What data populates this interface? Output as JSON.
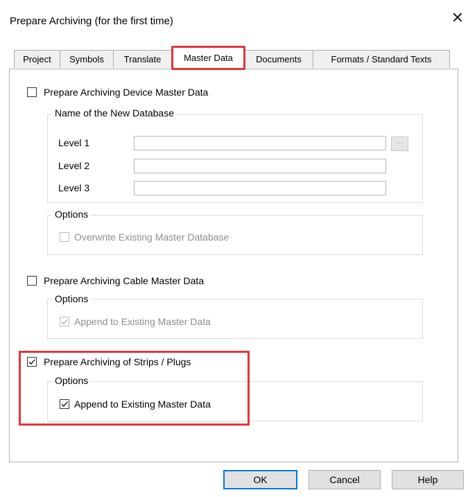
{
  "window": {
    "title": "Prepare Archiving (for the first time)",
    "close_glyph": "✕"
  },
  "tabs": [
    {
      "label": "Project",
      "active": false
    },
    {
      "label": "Symbols",
      "active": false
    },
    {
      "label": "Translate",
      "active": false
    },
    {
      "label": "Master Data",
      "active": true
    },
    {
      "label": "Documents",
      "active": false
    },
    {
      "label": "Formats / Standard Texts",
      "active": false
    }
  ],
  "device": {
    "checkbox_label": "Prepare Archiving Device Master Data",
    "checked": false,
    "db_group_title": "Name of the New Database",
    "levels": [
      {
        "label": "Level 1",
        "value": ""
      },
      {
        "label": "Level 2",
        "value": ""
      },
      {
        "label": "Level 3",
        "value": ""
      }
    ],
    "browse_label": "...",
    "options_title": "Options",
    "overwrite_label": "Overwrite Existing Master Database",
    "overwrite_checked": false,
    "overwrite_enabled": false
  },
  "cable": {
    "checkbox_label": "Prepare Archiving Cable Master Data",
    "checked": false,
    "options_title": "Options",
    "append_label": "Append to Existing Master Data",
    "append_checked": true,
    "append_enabled": false
  },
  "strips": {
    "checkbox_label": "Prepare Archiving of Strips / Plugs",
    "checked": true,
    "options_title": "Options",
    "append_label": "Append to Existing Master Data",
    "append_checked": true,
    "append_enabled": true
  },
  "buttons": {
    "ok": "OK",
    "cancel": "Cancel",
    "help": "Help"
  },
  "colors": {
    "highlight": "#e0363d",
    "default_button_border": "#0078d7",
    "disabled_text": "#8d8d8d"
  }
}
